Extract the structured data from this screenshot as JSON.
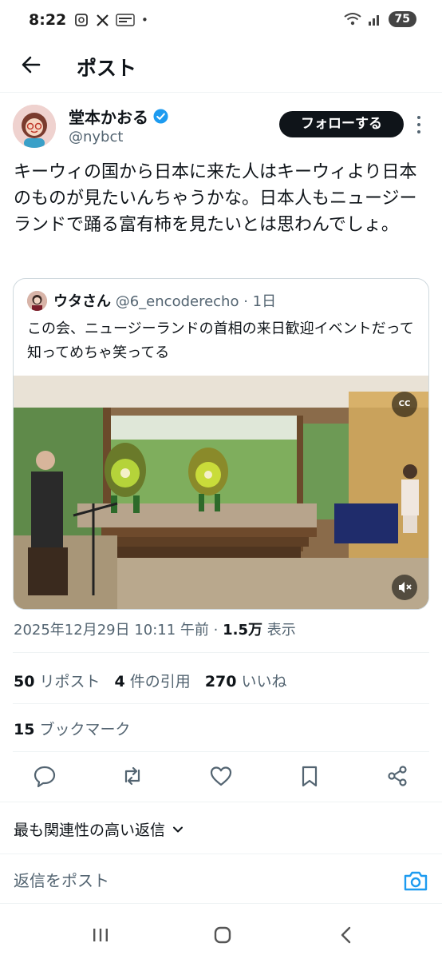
{
  "status_bar": {
    "time": "8:22",
    "carrier_icons": [
      "screenshot-icon",
      "x-icon",
      "manga-app-icon"
    ],
    "battery": "75"
  },
  "header": {
    "title": "ポスト"
  },
  "author": {
    "name": "堂本かおる",
    "handle": "@nybct",
    "follow_label": "フォローする"
  },
  "tweet": {
    "text": "キーウィの国から日本に来た人はキーウィより日本のものが見たいんちゃうかな。日本人もニュージーランドで踊る富有柿を見たいとは思わんでしょ。"
  },
  "quote": {
    "name": "ウタさん",
    "handle": "@6_encoderecho",
    "time": "· 1日",
    "text": "この会、ニュージーランドの首相の来日歓迎イベントだって知ってめちゃ笑ってる",
    "cc_label": "CC"
  },
  "meta": {
    "date": "2025年12月29日 10:11 午前 ·",
    "views": "1.5万",
    "views_label": "表示"
  },
  "stats": {
    "reposts": "50",
    "reposts_label": "リポスト",
    "quotes": "4",
    "quotes_label": "件の引用",
    "likes": "270",
    "likes_label": "いいね",
    "bookmarks": "15",
    "bookmarks_label": "ブックマーク"
  },
  "sort_label": "最も関連性の高い返信",
  "reply": {
    "placeholder": "返信をポスト"
  },
  "colors": {
    "accent": "#1d9bf0",
    "text": "#0f1419",
    "muted": "#536471"
  }
}
